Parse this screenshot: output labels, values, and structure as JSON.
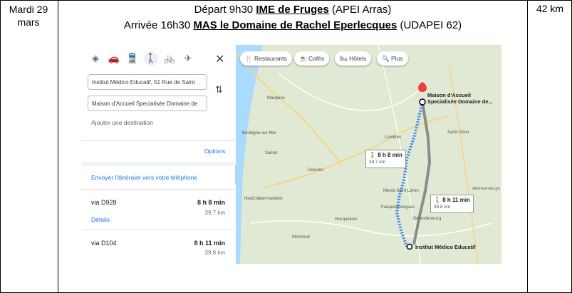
{
  "date": {
    "line1": "Mardi 29",
    "line2": "mars"
  },
  "distance_total": "42 km",
  "header": {
    "depart_prefix": "Départ 9h30 ",
    "depart_place": "IME de Fruges",
    "depart_suffix": " (APEI Arras)",
    "arrivee_prefix": "Arrivée 16h30 ",
    "arrivee_place": "MAS le Domaine de Rachel Eperlecques",
    "arrivee_suffix": " (UDAPEI 62)"
  },
  "directions": {
    "origin_value": "Institut Médico Educatif, 51 Rue de Saint",
    "destination_value": "Maison d'Accueil Specialisée Domaine de",
    "add_destination": "Ajouter une destination",
    "options": "Options",
    "send_to_phone": "Envoyer l'itinéraire vers votre téléphone",
    "routes": [
      {
        "via": "via D928",
        "time": "8 h 8 min",
        "distance": "39,7 km",
        "details": "Détails"
      },
      {
        "via": "via D104",
        "time": "8 h 11 min",
        "distance": "39,8 km"
      }
    ],
    "modes": [
      {
        "icon": "best-route-icon",
        "glyph": "◈"
      },
      {
        "icon": "car-icon",
        "glyph": "🚗"
      },
      {
        "icon": "transit-icon",
        "glyph": "🚆"
      },
      {
        "icon": "walking-icon",
        "glyph": "🚶"
      },
      {
        "icon": "bicycle-icon",
        "glyph": "🚲"
      },
      {
        "icon": "flight-icon",
        "glyph": "✈"
      }
    ]
  },
  "map": {
    "chips": [
      "Restaurants",
      "Cafés",
      "Hôtels",
      "Plus"
    ],
    "route_label_1": {
      "time": "8 h 8 min",
      "distance": "39,7 km"
    },
    "route_label_2": {
      "time": "8 h 11 min",
      "distance": "39,8 km"
    },
    "destination_label": "Maison d'Accueil Specialisée Domaine de...",
    "origin_label": "Institut Médico Educatif",
    "places": [
      "Marquise",
      "Boulogne-sur-Mer",
      "Desvres",
      "Lumbres",
      "Saint-Omer",
      "Aire-sur-la-Lys",
      "Fauquembergues",
      "Montreuil",
      "Hucqueliers",
      "Neufchâtel-Hardelot",
      "Samer",
      "Merck-Saint-Liévin",
      "Dennebroeucq"
    ],
    "colors": {
      "route_main": "#4285f4",
      "route_alt": "#8c8c8c",
      "land": "#dfe9d3",
      "sea": "#aadaff",
      "pin": "#ea4335"
    }
  }
}
